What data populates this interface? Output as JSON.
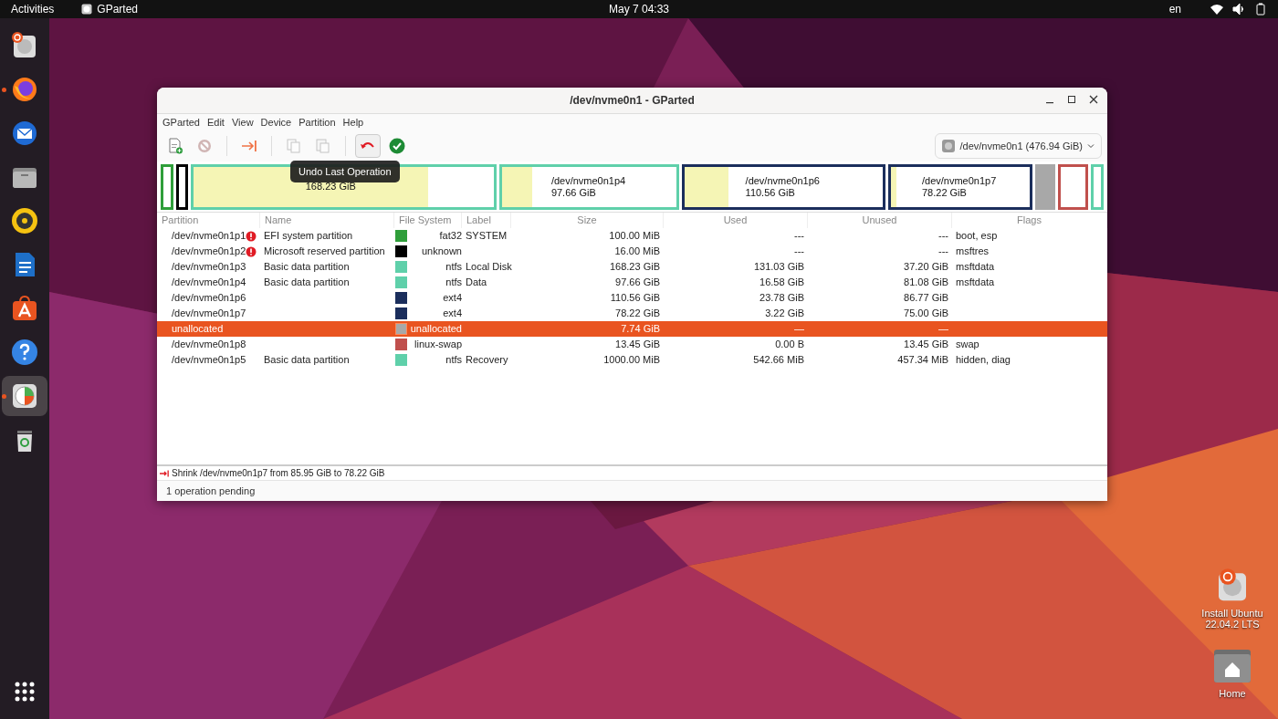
{
  "top_bar": {
    "activities": "Activities",
    "app": "GParted",
    "clock": "May 7  04:33",
    "input_source": "en"
  },
  "dock": [
    {
      "kind": "installer",
      "running": false,
      "selected": false
    },
    {
      "kind": "firefox",
      "running": true,
      "selected": false
    },
    {
      "kind": "mail",
      "running": false,
      "selected": false
    },
    {
      "kind": "files",
      "running": false,
      "selected": false
    },
    {
      "kind": "speaker",
      "running": false,
      "selected": false
    },
    {
      "kind": "writer",
      "running": false,
      "selected": false
    },
    {
      "kind": "store",
      "running": false,
      "selected": false
    },
    {
      "kind": "help",
      "running": false,
      "selected": false
    },
    {
      "kind": "gparted",
      "running": true,
      "selected": true
    },
    {
      "kind": "trash",
      "running": false,
      "selected": false
    }
  ],
  "desktop_icons": [
    {
      "kind": "installer",
      "label": "Install Ubuntu 22.04.2 LTS"
    },
    {
      "kind": "home",
      "label": "Home"
    }
  ],
  "window": {
    "title": "/dev/nvme0n1 - GParted",
    "menu": [
      "GParted",
      "Edit",
      "View",
      "Device",
      "Partition",
      "Help"
    ],
    "toolbar": [
      {
        "kind": "new",
        "disabled": false
      },
      {
        "kind": "delete",
        "disabled": true
      },
      {
        "kind": "separator"
      },
      {
        "kind": "resize",
        "disabled": false
      },
      {
        "kind": "separator"
      },
      {
        "kind": "copy",
        "disabled": true
      },
      {
        "kind": "paste",
        "disabled": true
      },
      {
        "kind": "separator"
      },
      {
        "kind": "undo",
        "disabled": false
      },
      {
        "kind": "apply",
        "disabled": false
      }
    ],
    "tooltip": "Undo Last Operation",
    "device": "/dev/nvme0n1 (476.94 GiB)",
    "map": [
      {
        "kind": "partition",
        "color": "#2f9e3a"
      },
      {
        "kind": "partition",
        "color": "#000000"
      },
      {
        "kind": "partition",
        "color": "#5fd0aa",
        "level": 0.78,
        "size": "168.23 GiB"
      },
      {
        "kind": "partition",
        "color": "#5fd0aa",
        "level": 0.17,
        "name": "/dev/nvme0n1p4",
        "size": "97.66 GiB"
      },
      {
        "kind": "partition",
        "color": "#1b2e5c",
        "level": 0.22,
        "name": "/dev/nvme0n1p6",
        "size": "110.56 GiB"
      },
      {
        "kind": "partition",
        "color": "#1b2e5c",
        "level": 0.04,
        "name": "/dev/nvme0n1p7",
        "size": "78.22 GiB"
      },
      {
        "kind": "unallocated",
        "color": "#a8a8a8"
      },
      {
        "kind": "partition",
        "color": "#c0504d"
      },
      {
        "kind": "partition",
        "color": "#5fd0aa"
      }
    ],
    "columns": [
      "Partition",
      "Name",
      "File System",
      "Label",
      "Size",
      "Used",
      "Unused",
      "Flags"
    ],
    "rows": [
      {
        "partition": "/dev/nvme0n1p1",
        "warning": true,
        "name": "EFI system partition",
        "color": "#2f9e3a",
        "filesystem": "fat32",
        "label": "SYSTEM",
        "size": "100.00 MiB",
        "used": "---",
        "unused": "---",
        "flags": "boot, esp",
        "selected": false
      },
      {
        "partition": "/dev/nvme0n1p2",
        "warning": true,
        "name": "Microsoft reserved partition",
        "color": "#000000",
        "filesystem": "unknown",
        "label": "",
        "size": "16.00 MiB",
        "used": "---",
        "unused": "---",
        "flags": "msftres",
        "selected": false
      },
      {
        "partition": "/dev/nvme0n1p3",
        "warning": false,
        "name": "Basic data partition",
        "color": "#5fd0aa",
        "filesystem": "ntfs",
        "label": "Local Disk",
        "size": "168.23 GiB",
        "used": "131.03 GiB",
        "unused": "37.20 GiB",
        "flags": "msftdata",
        "selected": false
      },
      {
        "partition": "/dev/nvme0n1p4",
        "warning": false,
        "name": "Basic data partition",
        "color": "#5fd0aa",
        "filesystem": "ntfs",
        "label": "Data",
        "size": "97.66 GiB",
        "used": "16.58 GiB",
        "unused": "81.08 GiB",
        "flags": "msftdata",
        "selected": false
      },
      {
        "partition": "/dev/nvme0n1p6",
        "warning": false,
        "name": "",
        "color": "#1b2e5c",
        "filesystem": "ext4",
        "label": "",
        "size": "110.56 GiB",
        "used": "23.78 GiB",
        "unused": "86.77 GiB",
        "flags": "",
        "selected": false
      },
      {
        "partition": "/dev/nvme0n1p7",
        "warning": false,
        "name": "",
        "color": "#1b2e5c",
        "filesystem": "ext4",
        "label": "",
        "size": "78.22 GiB",
        "used": "3.22 GiB",
        "unused": "75.00 GiB",
        "flags": "",
        "selected": false
      },
      {
        "partition": "unallocated",
        "warning": false,
        "name": "",
        "color": "#a8a8a8",
        "filesystem": "unallocated",
        "label": "",
        "size": "7.74 GiB",
        "used": "—",
        "unused": "—",
        "flags": "",
        "selected": true
      },
      {
        "partition": "/dev/nvme0n1p8",
        "warning": false,
        "name": "",
        "color": "#c0504d",
        "filesystem": "linux-swap",
        "label": "",
        "size": "13.45 GiB",
        "used": "0.00 B",
        "unused": "13.45 GiB",
        "flags": "swap",
        "selected": false
      },
      {
        "partition": "/dev/nvme0n1p5",
        "warning": false,
        "name": "Basic data partition",
        "color": "#5fd0aa",
        "filesystem": "ntfs",
        "label": "Recovery",
        "size": "1000.00 MiB",
        "used": "542.66 MiB",
        "unused": "457.34 MiB",
        "flags": "hidden, diag",
        "selected": false
      }
    ],
    "operations": [
      "Shrink /dev/nvme0n1p7 from 85.95 GiB to 78.22 GiB"
    ],
    "status": "1 operation pending"
  }
}
